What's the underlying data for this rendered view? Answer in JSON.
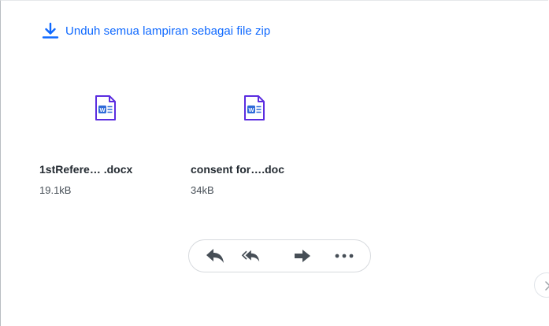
{
  "download_all": {
    "label": "Unduh semua lampiran sebagai file zip",
    "icon": "download-icon"
  },
  "attachments": [
    {
      "name": "1stRefere… .docx",
      "size": "19.1kB",
      "icon": "word-document-icon"
    },
    {
      "name": "consent for….doc",
      "size": "34kB",
      "icon": "word-document-icon"
    }
  ],
  "actions": [
    {
      "icon": "reply-icon"
    },
    {
      "icon": "reply-all-icon"
    },
    {
      "icon": "forward-icon"
    },
    {
      "icon": "more-icon"
    }
  ],
  "navigation": {
    "next_icon": "chevron-right-icon"
  },
  "colors": {
    "link": "#0f69ff",
    "word_icon": "#5b2de0",
    "action_icon": "#464e56",
    "text": "#232a31"
  }
}
